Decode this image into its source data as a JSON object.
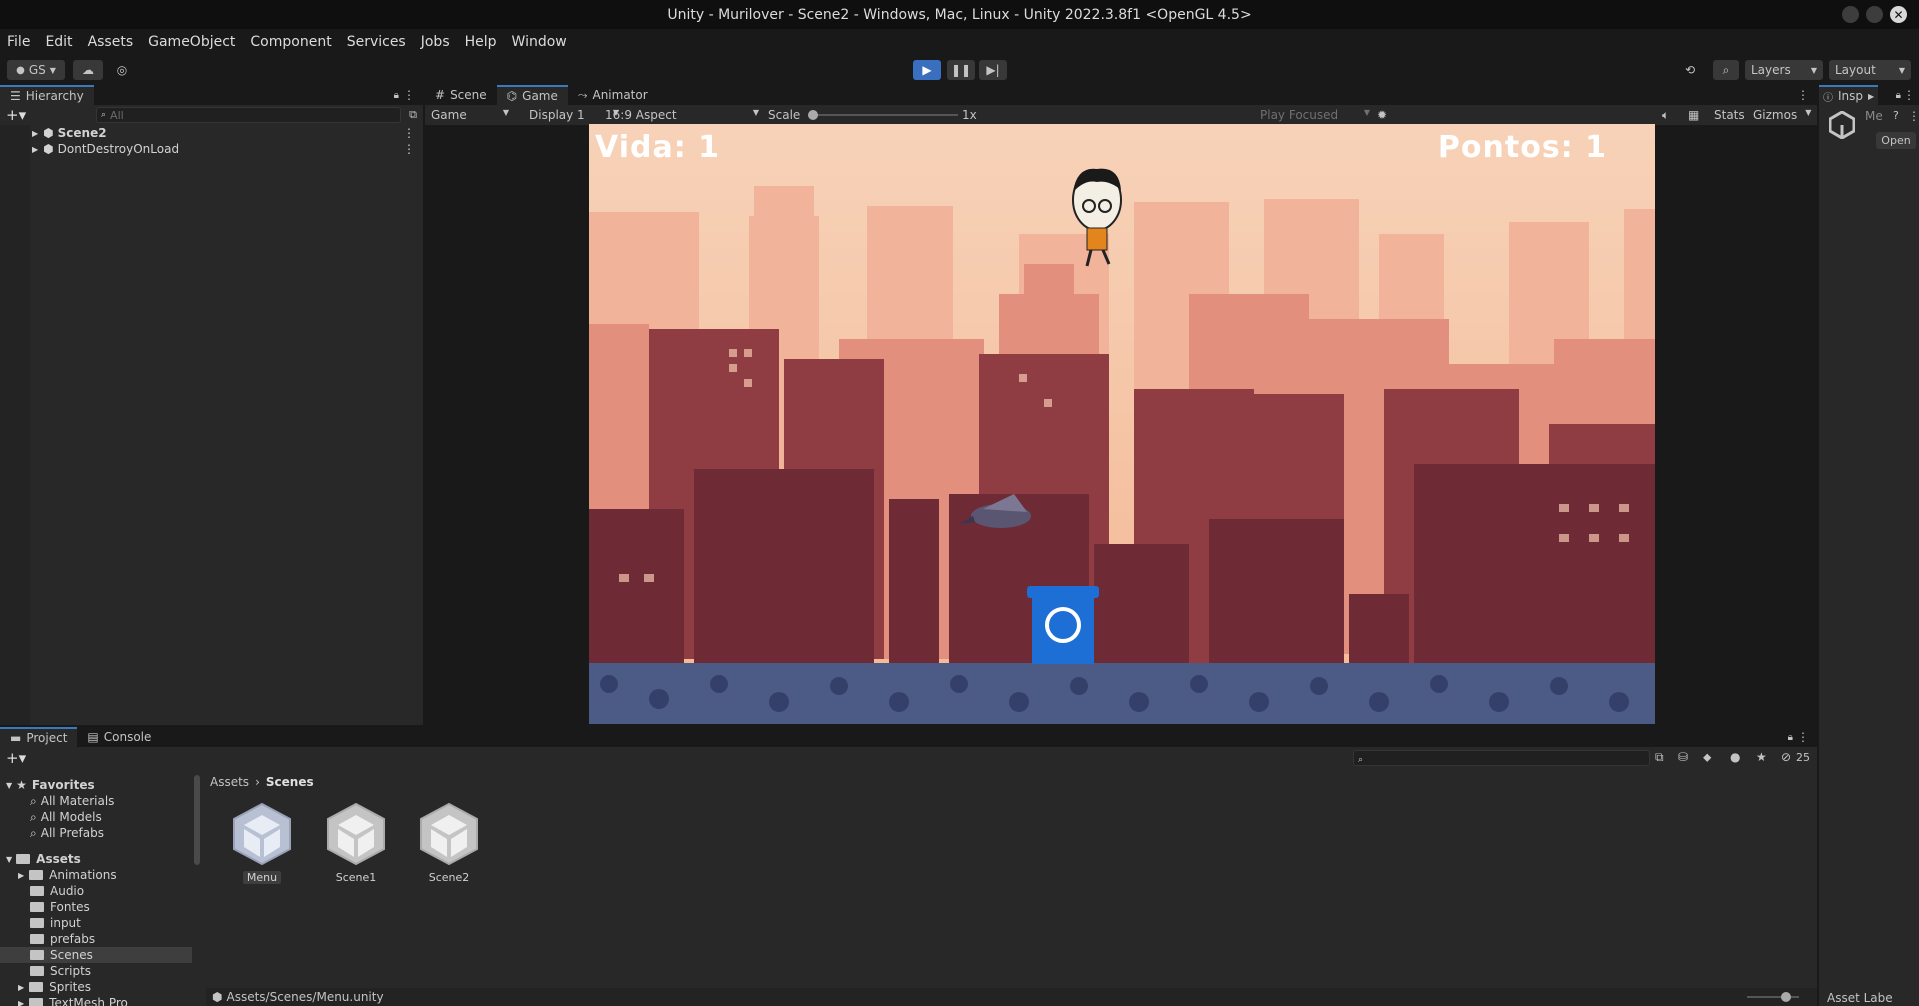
{
  "window": {
    "title": "Unity - Murilover - Scene2 - Windows, Mac, Linux - Unity 2022.3.8f1 <OpenGL 4.5>"
  },
  "menu": [
    "File",
    "Edit",
    "Assets",
    "GameObject",
    "Component",
    "Services",
    "Jobs",
    "Help",
    "Window"
  ],
  "toolbar": {
    "account": "GS",
    "layers_label": "Layers",
    "layout_label": "Layout"
  },
  "hierarchy": {
    "tab_label": "Hierarchy",
    "search_placeholder": "All",
    "items": [
      {
        "label": "Scene2"
      },
      {
        "label": "DontDestroyOnLoad"
      }
    ]
  },
  "center": {
    "tabs": [
      "Scene",
      "Game",
      "Animator"
    ],
    "game_dropdown": "Game",
    "display": "Display 1",
    "aspect": "16:9 Aspect",
    "scale_label": "Scale",
    "scale_value": "1x",
    "play_focused": "Play Focused",
    "stats": "Stats",
    "gizmos": "Gizmos"
  },
  "game": {
    "lives_text": "Vida: 1",
    "points_text": "Pontos: 1"
  },
  "inspector": {
    "tab_label": "Insp",
    "name_stub": "Me",
    "open_button": "Open",
    "asset_labels": "Asset Labe"
  },
  "project": {
    "tabs": [
      "Project",
      "Console"
    ],
    "hidden_count": "25",
    "favorites_label": "Favorites",
    "favorites": [
      "All Materials",
      "All Models",
      "All Prefabs"
    ],
    "assets_label": "Assets",
    "folders": [
      "Animations",
      "Audio",
      "Fontes",
      "input",
      "prefabs",
      "Scenes",
      "Scripts",
      "Sprites",
      "TextMesh Pro"
    ],
    "breadcrumb": [
      "Assets",
      "Scenes"
    ],
    "scene_assets": [
      "Menu",
      "Scene1",
      "Scene2"
    ],
    "status_path": "Assets/Scenes/Menu.unity"
  },
  "colors": {
    "accent": "#3a79bb",
    "play_active": "#3a6fbf",
    "sky": "#f5c7a8",
    "trash_can": "#1d6fd6"
  }
}
